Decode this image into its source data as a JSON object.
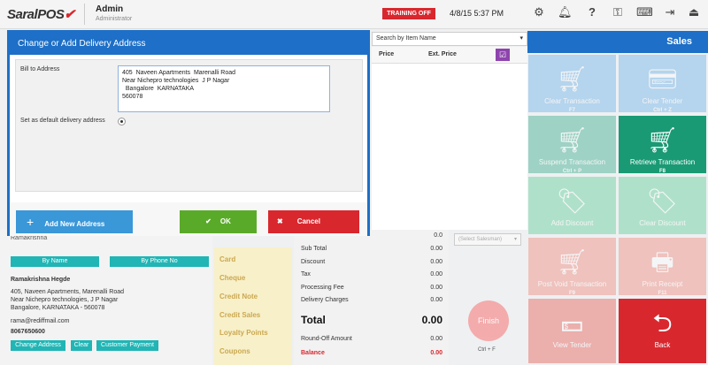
{
  "app": {
    "logo": "SaralPOS",
    "user_name": "Admin",
    "user_role": "Administrator",
    "training_label": "TRAINING OFF",
    "datetime": "4/8/15 5:37 PM"
  },
  "toolbar_icons": [
    "gear-icon",
    "bell-icon",
    "help-icon",
    "key-icon",
    "keyboard-icon",
    "logout-icon"
  ],
  "search": {
    "placeholder": "Search by Item Name"
  },
  "grid": {
    "columns": [
      "Price",
      "Ext. Price"
    ]
  },
  "sales": {
    "title": "Sales",
    "tiles": [
      {
        "label": "Clear Transaction",
        "shortcut": "F7",
        "icon": "cart-minus-icon",
        "color": "#5aa8e6",
        "active": false
      },
      {
        "label": "Clear Tender",
        "shortcut": "Ctrl + Z",
        "icon": "card-minus-icon",
        "color": "#5aa8e6",
        "active": false
      },
      {
        "label": "Suspend Transaction",
        "shortcut": "Ctrl + P",
        "icon": "cart-pause-icon",
        "color": "#1fa37a",
        "active": false
      },
      {
        "label": "Retrieve Transaction",
        "shortcut": "F8",
        "icon": "cart-play-icon",
        "color": "#1a9a74",
        "active": true
      },
      {
        "label": "Add Discount",
        "shortcut": "",
        "icon": "tag-plus-icon",
        "color": "#4cc98a",
        "active": false
      },
      {
        "label": "Clear Discount",
        "shortcut": "",
        "icon": "tag-minus-icon",
        "color": "#4cc98a",
        "active": false
      },
      {
        "label": "Post Void Transaction",
        "shortcut": "F9",
        "icon": "cart-minus-icon",
        "color": "#f27a6a",
        "active": false
      },
      {
        "label": "Print Receipt",
        "shortcut": "F11",
        "icon": "printer-icon",
        "color": "#f27a6a",
        "active": false
      },
      {
        "label": "View Tender",
        "shortcut": "",
        "icon": "cash-icon",
        "color": "#e8473d",
        "active": false
      },
      {
        "label": "Back",
        "shortcut": "",
        "icon": "back-arrow-icon",
        "color": "#d9272e",
        "active": true
      }
    ]
  },
  "totals": {
    "top_value": "0.0",
    "rows": [
      {
        "label": "Sub Total",
        "value": "0.00"
      },
      {
        "label": "Discount",
        "value": "0.00"
      },
      {
        "label": "Tax",
        "value": "0.00"
      },
      {
        "label": "Processing Fee",
        "value": "0.00"
      },
      {
        "label": "Delivery Charges",
        "value": "0.00"
      }
    ],
    "total_label": "Total",
    "total_value": "0.00",
    "roundoff_label": "Round-Off Amount",
    "roundoff_value": "0.00",
    "balance_label": "Balance",
    "balance_value": "0.00"
  },
  "payments": [
    "Card",
    "Cheque",
    "Credit Note",
    "Credit Sales",
    "Loyalty Points",
    "Coupons"
  ],
  "salesman": {
    "placeholder": "(Select Salesman)"
  },
  "finish": {
    "label": "Finish",
    "shortcut": "Ctrl + F"
  },
  "customer": {
    "search_value": "Ramakrishna",
    "by_name": "By Name",
    "by_phone": "By Phone No",
    "name": "Ramakrishna Hegde",
    "address_lines": [
      "405, Naveen Apartments, Marenalli Road",
      "Near Nichepro technologies, J P Nagar",
      "Bangalore, KARNATAKA - 560078"
    ],
    "email": "rama@rediffmail.com",
    "phone": "8067650600",
    "btn_change": "Change Address",
    "btn_clear": "Clear",
    "btn_payment": "Customer Payment"
  },
  "modal": {
    "title": "Change or Add Delivery Address",
    "bill_label": "Bill to Address",
    "address": "405  Naveen Apartments  Marenalli Road\nNear Nichepro technologies  J P Nagar\n  Bangalore  KARNATAKA\n560078",
    "default_label": "Set as default delivery address",
    "add_label": "Add New Address",
    "ok_label": "OK",
    "cancel_label": "Cancel"
  },
  "colors": {
    "blue": "#1d6fc7",
    "red": "#d9272e",
    "green": "#5aaa2a",
    "teal": "#21b5b5"
  }
}
